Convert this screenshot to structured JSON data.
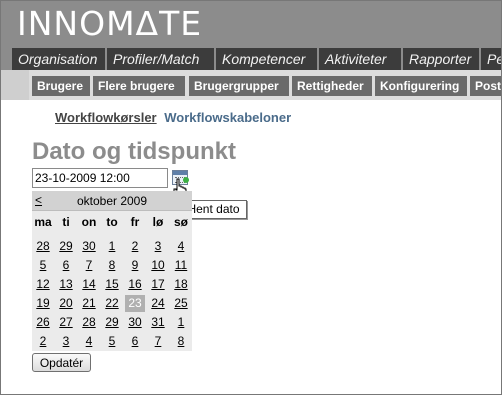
{
  "app": {
    "logo": "INNOMΔTE"
  },
  "nav": {
    "main_tabs": [
      {
        "label": "Organisation"
      },
      {
        "label": "Profiler/Match"
      },
      {
        "label": "Kompetencer"
      },
      {
        "label": "Aktiviteter"
      },
      {
        "label": "Rapporter"
      },
      {
        "label": "Pe"
      }
    ],
    "sub_tabs": [
      {
        "label": "Brugere"
      },
      {
        "label": "Flere brugere"
      },
      {
        "label": "Brugergrupper"
      },
      {
        "label": "Rettigheder"
      },
      {
        "label": "Konfigurering"
      },
      {
        "label": "Post"
      }
    ]
  },
  "page": {
    "links": {
      "workflow_runs": "Workflowkørsler",
      "workflow_templates": "Workflowskabeloner"
    },
    "title": "Dato og tidspunkt",
    "date_field": {
      "value": "23-10-2009 12:00"
    },
    "calendar_button": {
      "icon": "calendar-icon",
      "tooltip": "Hent dato"
    },
    "calendar": {
      "prev_label": "<",
      "month_label": "oktober 2009",
      "weekdays": [
        "ma",
        "ti",
        "on",
        "to",
        "fr",
        "lø",
        "sø"
      ],
      "weeks": [
        [
          "28",
          "29",
          "30",
          "1",
          "2",
          "3",
          "4"
        ],
        [
          "5",
          "6",
          "7",
          "8",
          "9",
          "10",
          "11"
        ],
        [
          "12",
          "13",
          "14",
          "15",
          "16",
          "17",
          "18"
        ],
        [
          "19",
          "20",
          "21",
          "22",
          "23",
          "24",
          "25"
        ],
        [
          "26",
          "27",
          "28",
          "29",
          "30",
          "31",
          "1"
        ],
        [
          "2",
          "3",
          "4",
          "5",
          "6",
          "7",
          "8"
        ]
      ],
      "selected_day": "23"
    },
    "update_button": "Opdatér"
  },
  "colors": {
    "header_bg": "#8c8c8c",
    "tab_bg": "#3c3c3c",
    "subtab_bg": "#6a6a6a",
    "subnav_bg": "#dcdcdc",
    "link_active": "#4a6b8a"
  }
}
